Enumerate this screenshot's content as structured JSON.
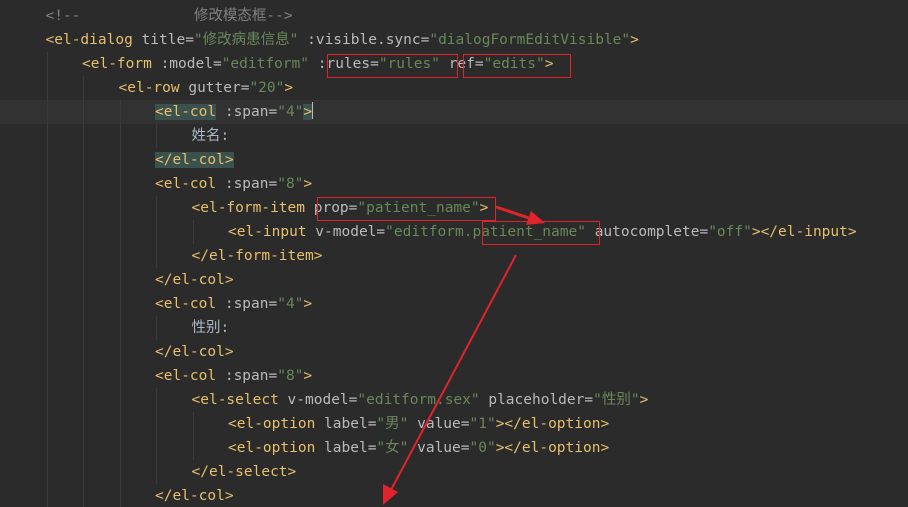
{
  "editor": {
    "lines": [
      {
        "indent": 1,
        "tokens": [
          {
            "t": "<!--             修改模态框-->",
            "c": "cmt"
          }
        ]
      },
      {
        "indent": 1,
        "tokens": [
          {
            "t": "<el-dialog",
            "c": "tag"
          },
          {
            "t": " title=",
            "c": "attr"
          },
          {
            "t": "\"修改病患信息\"",
            "c": "val"
          },
          {
            "t": " :visible.sync=",
            "c": "attr"
          },
          {
            "t": "\"dialogFormEditVisible\"",
            "c": "val"
          },
          {
            "t": ">",
            "c": "tag"
          }
        ]
      },
      {
        "indent": 2,
        "tokens": [
          {
            "t": "<el-form",
            "c": "tag"
          },
          {
            "t": " :model=",
            "c": "attr"
          },
          {
            "t": "\"editform\"",
            "c": "val"
          },
          {
            "t": " ",
            "c": "attr"
          },
          {
            "t": ":rules=",
            "c": "attr"
          },
          {
            "t": "\"rules\"",
            "c": "val"
          },
          {
            "t": " ",
            "c": "attr"
          },
          {
            "t": "ref=",
            "c": "attr"
          },
          {
            "t": "\"edits\"",
            "c": "val"
          },
          {
            "t": ">",
            "c": "tag"
          }
        ]
      },
      {
        "indent": 3,
        "tokens": [
          {
            "t": "<el-row",
            "c": "tag"
          },
          {
            "t": " gutter=",
            "c": "attr"
          },
          {
            "t": "\"20\"",
            "c": "val"
          },
          {
            "t": ">",
            "c": "tag"
          }
        ]
      },
      {
        "indent": 4,
        "current": true,
        "tokens": [
          {
            "t": "<el-col",
            "c": "tag",
            "hl": true
          },
          {
            "t": " :span=",
            "c": "attr"
          },
          {
            "t": "\"4\"",
            "c": "val"
          },
          {
            "t": ">",
            "c": "tag",
            "hl": true
          }
        ],
        "caret": true
      },
      {
        "indent": 5,
        "tokens": [
          {
            "t": "姓名:",
            "c": "txt-plain"
          }
        ]
      },
      {
        "indent": 4,
        "tokens": [
          {
            "t": "</el-col>",
            "c": "tag",
            "hl": true
          }
        ]
      },
      {
        "indent": 4,
        "tokens": [
          {
            "t": "<el-col",
            "c": "tag"
          },
          {
            "t": " :span=",
            "c": "attr"
          },
          {
            "t": "\"8\"",
            "c": "val"
          },
          {
            "t": ">",
            "c": "tag"
          }
        ]
      },
      {
        "indent": 5,
        "tokens": [
          {
            "t": "<el-form-item",
            "c": "tag"
          },
          {
            "t": " ",
            "c": "attr"
          },
          {
            "t": "prop=",
            "c": "attr"
          },
          {
            "t": "\"patient_name\"",
            "c": "val"
          },
          {
            "t": ">",
            "c": "tag"
          }
        ]
      },
      {
        "indent": 6,
        "tokens": [
          {
            "t": "<el-input",
            "c": "tag"
          },
          {
            "t": " v-model=",
            "c": "attr"
          },
          {
            "t": "\"editform.",
            "c": "val"
          },
          {
            "t": "patient_name\"",
            "c": "val"
          },
          {
            "t": " autocomplete=",
            "c": "attr"
          },
          {
            "t": "\"off\"",
            "c": "val"
          },
          {
            "t": "></el-input>",
            "c": "tag"
          }
        ]
      },
      {
        "indent": 5,
        "tokens": [
          {
            "t": "</el-form-item>",
            "c": "tag"
          }
        ]
      },
      {
        "indent": 4,
        "tokens": [
          {
            "t": "</el-col>",
            "c": "tag"
          }
        ]
      },
      {
        "indent": 4,
        "tokens": [
          {
            "t": "<el-col",
            "c": "tag"
          },
          {
            "t": " :span=",
            "c": "attr"
          },
          {
            "t": "\"4\"",
            "c": "val"
          },
          {
            "t": ">",
            "c": "tag"
          }
        ]
      },
      {
        "indent": 5,
        "tokens": [
          {
            "t": "性别:",
            "c": "txt-plain"
          }
        ]
      },
      {
        "indent": 4,
        "tokens": [
          {
            "t": "</el-col>",
            "c": "tag"
          }
        ]
      },
      {
        "indent": 4,
        "tokens": [
          {
            "t": "<el-col",
            "c": "tag"
          },
          {
            "t": " :span=",
            "c": "attr"
          },
          {
            "t": "\"8\"",
            "c": "val"
          },
          {
            "t": ">",
            "c": "tag"
          }
        ]
      },
      {
        "indent": 5,
        "tokens": [
          {
            "t": "<el-select",
            "c": "tag"
          },
          {
            "t": " v-model=",
            "c": "attr"
          },
          {
            "t": "\"editform.sex\"",
            "c": "val"
          },
          {
            "t": " placeholder=",
            "c": "attr"
          },
          {
            "t": "\"性别\"",
            "c": "val"
          },
          {
            "t": ">",
            "c": "tag"
          }
        ]
      },
      {
        "indent": 6,
        "tokens": [
          {
            "t": "<el-option",
            "c": "tag"
          },
          {
            "t": " label=",
            "c": "attr"
          },
          {
            "t": "\"男\"",
            "c": "val"
          },
          {
            "t": " value=",
            "c": "attr"
          },
          {
            "t": "\"1\"",
            "c": "val"
          },
          {
            "t": "></el-option>",
            "c": "tag"
          }
        ]
      },
      {
        "indent": 6,
        "tokens": [
          {
            "t": "<el-option",
            "c": "tag"
          },
          {
            "t": " label=",
            "c": "attr"
          },
          {
            "t": "\"女\"",
            "c": "val"
          },
          {
            "t": " value=",
            "c": "attr"
          },
          {
            "t": "\"0\"",
            "c": "val"
          },
          {
            "t": "></el-option>",
            "c": "tag"
          }
        ]
      },
      {
        "indent": 5,
        "tokens": [
          {
            "t": "</el-select>",
            "c": "tag"
          }
        ]
      },
      {
        "indent": 4,
        "tokens": [
          {
            "t": "</el-col>",
            "c": "tag"
          }
        ]
      }
    ]
  },
  "colors": {
    "background": "#2b2b2b",
    "tag": "#e8bf6a",
    "attribute": "#bababa",
    "string": "#6a8759",
    "comment": "#808080",
    "annotation_red": "#e0242b"
  }
}
